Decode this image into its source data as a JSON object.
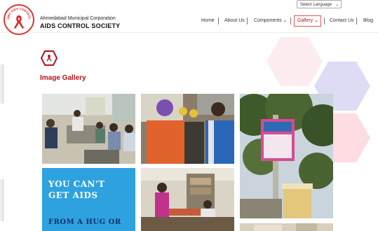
{
  "language_select": {
    "value": "Select Language"
  },
  "header": {
    "org_name": "Ahmedabad Municipal Corporation",
    "site_name": "AIDS CONTROL SOCIETY",
    "logo_text": "AMC AIDS CONTROL SOCIETY"
  },
  "nav": {
    "home": "Home",
    "about": "About Us",
    "components": "Components",
    "gallery": "Gallery",
    "contact": "Contact Us",
    "blog": "Blog"
  },
  "page": {
    "title": "Image Gallery"
  },
  "gallery": {
    "banner_line1": "YOU CAN'T",
    "banner_line2": "GET AIDS",
    "banner_line3": "FROM A HUG OR"
  },
  "colors": {
    "accent": "#b5121b",
    "banner": "#2da2df"
  }
}
